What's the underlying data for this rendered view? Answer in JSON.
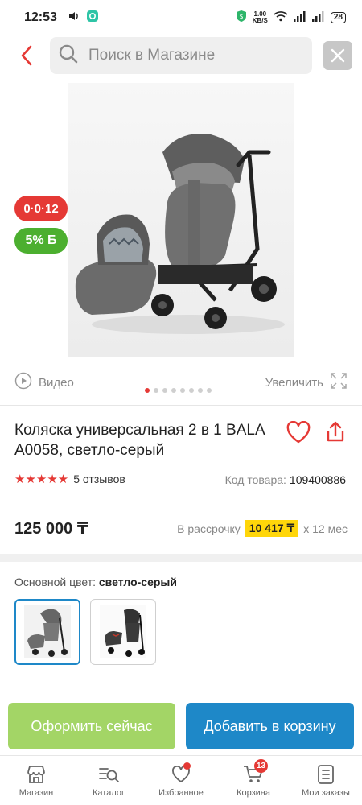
{
  "status_bar": {
    "time": "12:53",
    "net_speed_value": "1.00",
    "net_speed_unit": "KB/S",
    "battery": "28"
  },
  "search": {
    "placeholder": "Поиск в Магазине"
  },
  "badges": {
    "installment": "0·0·12",
    "bonus": "5% Б"
  },
  "media": {
    "video_label": "Видео",
    "zoom_label": "Увеличить",
    "dots_total": 8,
    "dots_active": 1
  },
  "product": {
    "title": "Коляска универсальная 2 в 1 BALA A0058, светло-серый",
    "rating": 5,
    "stars": "★★★★★",
    "reviews": "5 отзывов",
    "sku_label": "Код товара:",
    "sku": "109400886",
    "price": "125 000 ₸",
    "installment_label": "В рассрочку",
    "installment_amount": "10 417 ₸",
    "installment_term": "x 12 мес",
    "color_label": "Основной цвет:",
    "color_value": "светло-серый"
  },
  "actions": {
    "buy_now": "Оформить сейчас",
    "add_to_cart": "Добавить в корзину"
  },
  "nav": {
    "items": [
      {
        "label": "Магазин",
        "icon": "shop-icon"
      },
      {
        "label": "Каталог",
        "icon": "catalog-icon"
      },
      {
        "label": "Избранное",
        "icon": "heart-icon"
      },
      {
        "label": "Корзина",
        "icon": "cart-icon",
        "badge": "13"
      },
      {
        "label": "Мои заказы",
        "icon": "orders-icon"
      }
    ]
  },
  "colors": {
    "accent_red": "#e53935",
    "bonus_green": "#4caf2f",
    "buy_green": "#a3d566",
    "cart_blue": "#1e88c8",
    "installment_yellow": "#ffd60a"
  }
}
